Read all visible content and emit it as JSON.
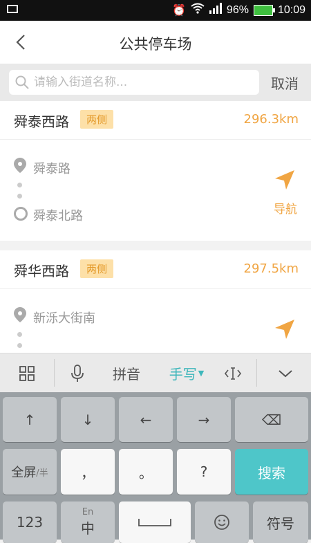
{
  "status_bar": {
    "battery": "96%",
    "time": "10:09"
  },
  "header": {
    "title": "公共停车场",
    "back_icon": "back-chevron-icon"
  },
  "search": {
    "placeholder": "请输入街道名称...",
    "cancel_label": "取消"
  },
  "results": [
    {
      "road": "舜泰西路",
      "tag": "两侧",
      "distance": "296.3km",
      "start": "舜泰路",
      "end": "舜泰北路",
      "nav_label": "导航"
    },
    {
      "road": "舜华西路",
      "tag": "两侧",
      "distance": "297.5km",
      "start": "新泺大街南",
      "nav_label": "导航"
    }
  ],
  "keyboard": {
    "toolbar": {
      "pinyin_label": "拼音",
      "handwriting_label": "手写",
      "grid_icon": "grid-icon",
      "mic_icon": "microphone-icon",
      "cursor_icon": "cursor-move-icon",
      "collapse_icon": "chevron-down-icon"
    },
    "row1": [
      "↑",
      "↓",
      "←",
      "→",
      "⌫"
    ],
    "row2": {
      "fullwidth": "全屏",
      "halfwidth": "半",
      "comma": "，",
      "period": "。",
      "question": "?",
      "search": "搜索"
    },
    "row3": {
      "num": "123",
      "lang_top": "En",
      "lang_main": "中",
      "symbol": "符号"
    }
  },
  "colors": {
    "accent": "#f0a543",
    "teal": "#4ec6c9"
  }
}
